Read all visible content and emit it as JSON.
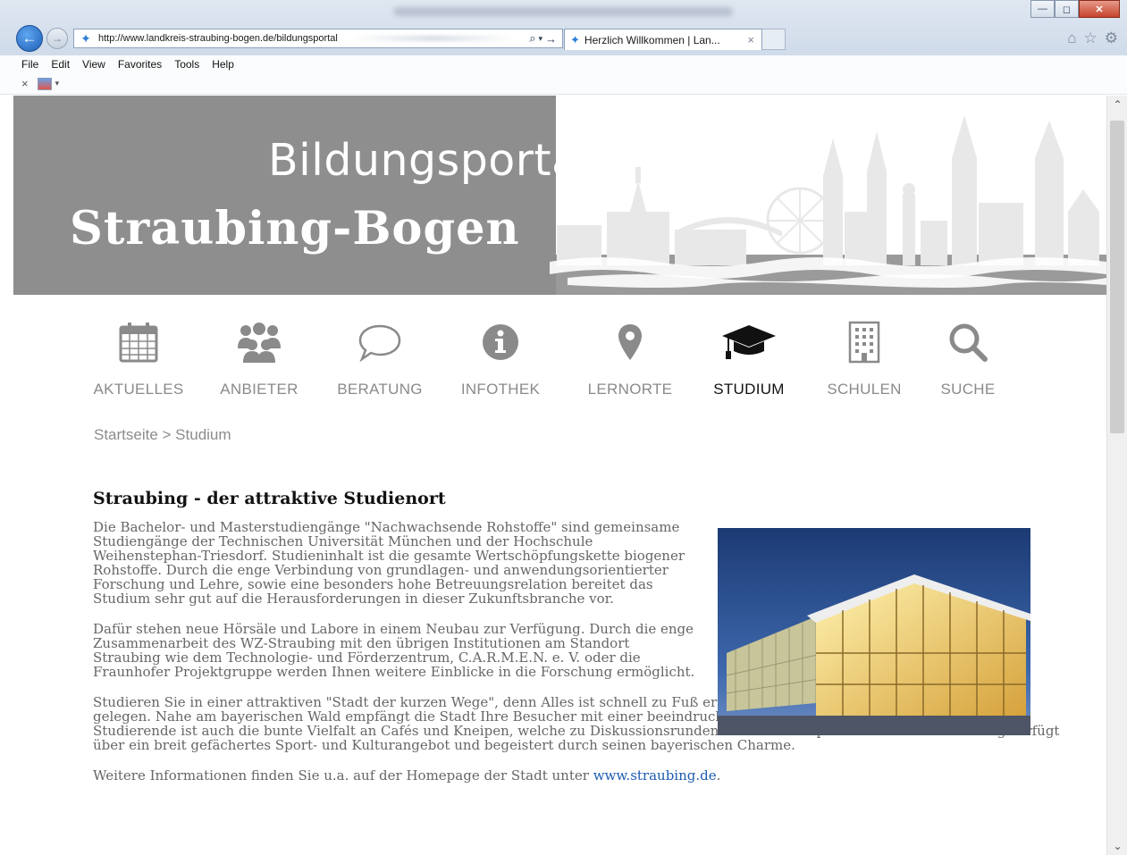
{
  "browser": {
    "url": "http://www.landkreis-straubing-bogen.de/bildungsportal",
    "tab_title": "Herzlich Willkommen | Lan...",
    "tab_close": "×",
    "back_icon": "back-arrow-icon",
    "forward_icon": "forward-arrow-icon",
    "search_icon": "search-icon",
    "menu": [
      "File",
      "Edit",
      "View",
      "Favorites",
      "Tools",
      "Help"
    ],
    "cmd_close": "×"
  },
  "hero": {
    "title_line1": "Bildungsportal",
    "title_line2": "Straubing-Bogen",
    "band_color": "#8e8e8e"
  },
  "nav": {
    "items": [
      {
        "label": "AKTUELLES",
        "icon": "calendar-icon"
      },
      {
        "label": "ANBIETER",
        "icon": "group-icon"
      },
      {
        "label": "BERATUNG",
        "icon": "speech-bubble-icon"
      },
      {
        "label": "INFOTHEK",
        "icon": "info-icon"
      },
      {
        "label": "LERNORTE",
        "icon": "map-pin-icon"
      },
      {
        "label": "STUDIUM",
        "icon": "graduation-cap-icon",
        "active": true
      },
      {
        "label": "SCHULEN",
        "icon": "building-icon"
      },
      {
        "label": "SUCHE",
        "icon": "search-icon"
      }
    ]
  },
  "breadcrumb": "Startseite > Studium",
  "content": {
    "headline": "Straubing - der attraktive Studienort",
    "p1": "Die Bachelor- und Masterstudiengänge \"Nachwachsende Rohstoffe\" sind gemeinsame Studiengänge der Technischen Universität München und der Hochschule Weihenstephan-Triesdorf. Studieninhalt ist die gesamte Wertschöpfungskette biogener Rohstoffe. Durch die enge Verbindung von grundlagen- und anwendungsorientierter Forschung und Lehre, sowie eine besonders hohe Betreuungsrelation bereitet das Studium sehr gut auf die Herausforderungen in dieser Zukunftsbranche vor.",
    "p2": "Dafür stehen neue Hörsäle und Labore in einem Neubau zur Verfügung. Durch die enge Zusammenarbeit des WZ-Straubing mit den übrigen Institutionen am Standort Straubing wie dem Technologie- und Förderzentrum, C.A.R.M.E.N. e. V. oder die Fraunhofer Projektgruppe werden Ihnen weitere Einblicke in die Forschung ermöglicht.",
    "p3": "Studieren Sie in einer attraktiven \"Stadt der kurzen Wege\", denn Alles ist schnell zu Fuß erreichbar. Straubing ist idyllisch an der Donau gelegen. Nahe am bayerischen Wald empfängt die Stadt Ihre Besucher mit einer beeindruckenden Stadtsilhouette. Von Interesse für Studierende ist auch die bunte Vielfalt an Cafés und Kneipen, welche zu Diskussionsrunden und zum Entspannen einladen. Straubing verfügt über ein breit gefächertes Sport- und Kulturangebot und begeistert durch seinen bayerischen Charme.",
    "p4_prefix": "Weitere Informationen finden Sie u.a. auf der Homepage der Stadt unter ",
    "p4_link": "www.straubing.de",
    "p4_suffix": ".",
    "link_color": "#1d5bb0"
  }
}
